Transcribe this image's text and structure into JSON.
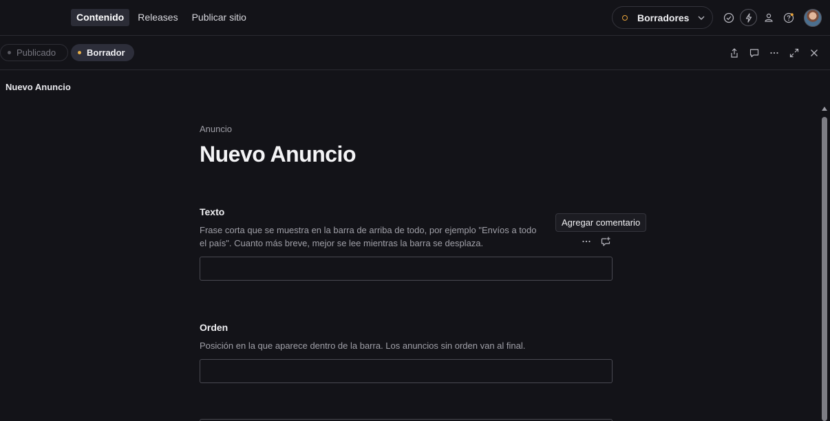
{
  "nav": {
    "items": [
      {
        "label": "Contenido",
        "active": true
      },
      {
        "label": "Releases",
        "active": false
      },
      {
        "label": "Publicar sitio",
        "active": false
      }
    ]
  },
  "perspective": {
    "label": "Borradores",
    "dot_color": "#e8a33a"
  },
  "toolbar_icons": [
    "check-circle-icon",
    "lightning-icon",
    "people-icon",
    "help-icon",
    "avatar"
  ],
  "document_bar": {
    "chips": [
      {
        "label": "Publicado",
        "dot_color": "#5a5a62"
      },
      {
        "label": "Borrador",
        "dot_color": "#e8b04a"
      }
    ],
    "actions": [
      "share-icon",
      "comment-icon",
      "more-icon",
      "expand-icon",
      "close-icon"
    ]
  },
  "pane": {
    "title": "Nuevo Anuncio"
  },
  "document": {
    "type": "Anuncio",
    "title": "Nuevo Anuncio"
  },
  "fields": [
    {
      "label": "Texto",
      "description": "Frase corta que se muestra en la barra de arriba de todo, por ejemplo \"Envíos a todo el país\". Cuanto más breve, mejor se lee mientras la barra se desplaza.",
      "value": ""
    },
    {
      "label": "Orden",
      "description": "Posición en la que aparece dentro de la barra. Los anuncios sin orden van al final.",
      "value": ""
    }
  ],
  "tooltip": {
    "text": "Agregar comentario"
  },
  "colors": {
    "background": "#131318",
    "accent_draft": "#e8b04a"
  }
}
